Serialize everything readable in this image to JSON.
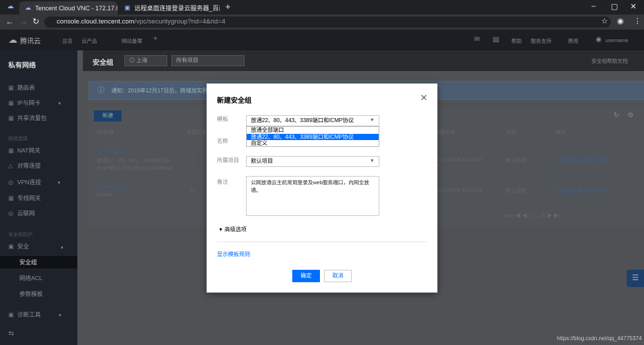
{
  "browser": {
    "tabs": [
      {
        "title": "Tencent Cloud VNC - 172.17.0...",
        "active": true
      },
      {
        "title": "远程桌面连接登录云服务器_百度...",
        "active": false
      }
    ],
    "new_tab": "+",
    "url_host": "console.cloud.tencent.com",
    "url_path": "/vpc/securitygroup?rid=4&rid=4",
    "window_controls": [
      "–",
      "▢",
      "✕"
    ]
  },
  "topbar": {
    "logo": "腾讯云",
    "nav": [
      "总览",
      "云产品",
      "网站备案"
    ],
    "right": [
      "帮助",
      "服务支持",
      "费用",
      "username"
    ]
  },
  "sidebar": {
    "title": "私有网络",
    "items": [
      {
        "label": "路由表",
        "icon": "▦"
      },
      {
        "label": "IP与网卡",
        "icon": "▦"
      },
      {
        "label": "共享流量包",
        "icon": "▦"
      },
      {
        "label": "NAT网关",
        "icon": "▦"
      },
      {
        "label": "对等连接",
        "icon": "△"
      },
      {
        "label": "VPN连接",
        "icon": "◎"
      },
      {
        "label": "专线网关",
        "icon": "▦"
      },
      {
        "label": "云联网",
        "icon": "◎"
      },
      {
        "label": "安全",
        "icon": "▣"
      },
      {
        "label": "安全组",
        "icon": ""
      },
      {
        "label": "网络ACL",
        "icon": ""
      },
      {
        "label": "参数模板",
        "icon": ""
      },
      {
        "label": "诊断工具",
        "icon": "▣"
      }
    ],
    "groups": [
      "网络连接",
      "安全和防护"
    ],
    "collapse_icon": "⇆"
  },
  "page": {
    "title": "安全组",
    "region": "上海",
    "project": "所有项目",
    "doc_link": "安全组帮助文档",
    "notice": "通知：2019年12月17日后，跨域加实例...",
    "new_button": "新建",
    "rows": [
      {
        "id": "sg-4nn7ptrx",
        "name": "放通22，80，443，3389端口和ICMP协议-202105016274188241",
        "count": "1",
        "time": "2021-05-06 16:26:52",
        "project": "默认项目",
        "ops": "修改规则  管理实例  更多"
      },
      {
        "id": "sg-4mkaytxc",
        "name": "default",
        "count": "0",
        "time": "2021-05-06 16:23:33",
        "project": "默认项目",
        "ops": "修改规则  管理实例  更多"
      }
    ],
    "pagination": "20 ▾  |◀  ◀  1 / 1 页  ▶  ▶|",
    "table_header": [
      "ID/名称",
      "关联实例数",
      "创建时间",
      "项目",
      "操作"
    ]
  },
  "modal": {
    "title": "新建安全组",
    "labels": {
      "template": "模板",
      "name": "名称",
      "project": "所属项目",
      "remark": "备注"
    },
    "template_value": "放通22、80、443、3389端口和ICMP协议",
    "template_options": [
      "放通全部端口",
      "放通22、80、443、3389端口和ICMP协议",
      "自定义"
    ],
    "project_value": "默认项目",
    "remark_value": "公网放通云主机常用登录及web服务端口，内网全放通。",
    "advanced": "高级选项",
    "template_rules_link": "显示模板规则",
    "ok": "确定",
    "cancel": "取消"
  },
  "watermark": "https://blog.csdn.net/qq_44775374",
  "colors": {
    "primary": "#006eff",
    "arrow": "#e0302a",
    "sidebar": "#1e222a"
  }
}
